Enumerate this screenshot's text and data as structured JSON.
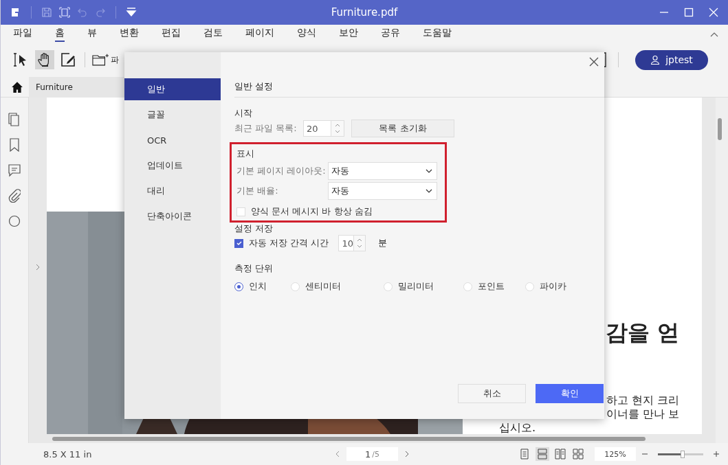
{
  "window": {
    "title": "Furniture.pdf"
  },
  "quick_tools": [
    {
      "kind": "logo"
    },
    {
      "kind": "save"
    },
    {
      "kind": "fit"
    },
    {
      "kind": "undo"
    },
    {
      "kind": "redo"
    },
    {
      "kind": "dropdown"
    }
  ],
  "menu": [
    {
      "label": "파일",
      "selected": false
    },
    {
      "label": "홈",
      "selected": true
    },
    {
      "label": "뷰",
      "selected": false
    },
    {
      "label": "변환",
      "selected": false
    },
    {
      "label": "편집",
      "selected": false
    },
    {
      "label": "검토",
      "selected": false
    },
    {
      "label": "페이지",
      "selected": false
    },
    {
      "label": "양식",
      "selected": false
    },
    {
      "label": "보안",
      "selected": false
    },
    {
      "label": "공유",
      "selected": false
    },
    {
      "label": "도움말",
      "selected": false
    }
  ],
  "tools": [
    {
      "kind": "select",
      "selected": false
    },
    {
      "kind": "hand",
      "selected": true
    },
    {
      "kind": "edit",
      "selected": false
    }
  ],
  "toolbar_partial_label": "파",
  "user": {
    "name": "jptest"
  },
  "tab": {
    "label": "Furniture"
  },
  "rail": [
    {
      "kind": "pages"
    },
    {
      "kind": "bookmark"
    },
    {
      "kind": "comment"
    },
    {
      "kind": "attachment"
    },
    {
      "kind": "search"
    }
  ],
  "document": {
    "heading": "감을 얻",
    "lines": [
      "하고 현지 크리",
      "이너를 만나 보",
      "십시오."
    ]
  },
  "dialog": {
    "nav": [
      {
        "label": "일반",
        "selected": true
      },
      {
        "label": "글꼴",
        "selected": false
      },
      {
        "label": "OCR",
        "selected": false
      },
      {
        "label": "업데이트",
        "selected": false
      },
      {
        "label": "대리",
        "selected": false
      },
      {
        "label": "단축아이콘",
        "selected": false
      }
    ],
    "title": "일반 설정",
    "start": {
      "heading": "시작",
      "label": "최근 파일 목록:",
      "value": "20",
      "button": "목록 초기화"
    },
    "display": {
      "heading": "표시",
      "highlighted": true,
      "selects": [
        {
          "label": "기본 페이지 레이아웃:",
          "value": "자동"
        },
        {
          "label": "기본 배율:",
          "value": "자동"
        }
      ],
      "checkbox": {
        "label": "양식 문서 메시지 바 항상 숨김",
        "checked": false
      }
    },
    "save": {
      "heading": "설정 저장",
      "checkbox": {
        "label": "자동 저장 간격 시간",
        "checked": true
      },
      "value": "10",
      "unit": "분"
    },
    "units": {
      "heading": "측정 단위",
      "options": [
        {
          "label": "인치",
          "selected": true
        },
        {
          "label": "센티미터",
          "selected": false
        },
        {
          "label": "밀리미터",
          "selected": false
        },
        {
          "label": "포인트",
          "selected": false
        },
        {
          "label": "파이카",
          "selected": false
        }
      ]
    },
    "buttons": [
      {
        "label": "취소",
        "kind": "secondary"
      },
      {
        "label": "확인",
        "kind": "primary"
      }
    ]
  },
  "status": {
    "page_size": "8.5 X 11 in",
    "page": "1",
    "page_total": "/5",
    "views": [
      {
        "kind": "single",
        "selected": false
      },
      {
        "kind": "continuous",
        "selected": true
      },
      {
        "kind": "double",
        "selected": false
      },
      {
        "kind": "grid",
        "selected": false
      }
    ],
    "zoom": "125%",
    "zoom_slider": {
      "level": 0.55
    }
  }
}
